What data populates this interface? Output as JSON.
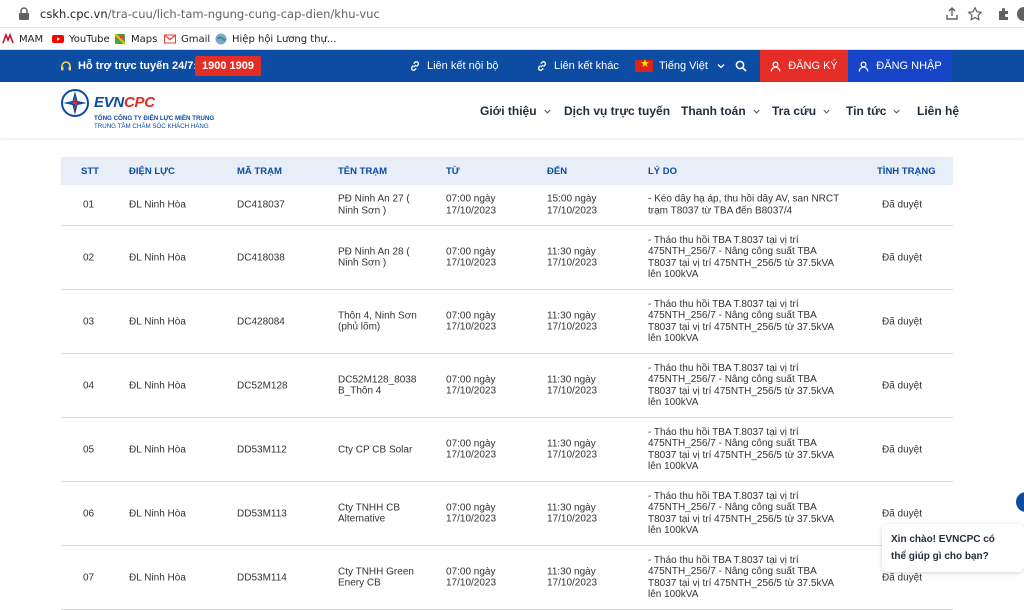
{
  "browser": {
    "url_host": "cskh.cpc.vn",
    "url_path": "/tra-cuu/lich-tam-ngung-cung-cap-dien/khu-vuc",
    "bookmarks": [
      {
        "label": "MAM",
        "icon": "mam-icon"
      },
      {
        "label": "YouTube",
        "icon": "youtube-icon"
      },
      {
        "label": "Maps",
        "icon": "maps-icon"
      },
      {
        "label": "Gmail",
        "icon": "gmail-icon"
      },
      {
        "label": "Hiệp hội Lương thự...",
        "icon": "globe-icon"
      }
    ]
  },
  "topbar": {
    "support_label": "Hỗ trợ trực tuyến 24/7:",
    "hotline": "1900 1909",
    "link_internal": "Liên kết nội bộ",
    "link_external": "Liên kết khác",
    "language": "Tiếng Việt",
    "register": "ĐĂNG KÝ",
    "login": "ĐĂNG NHẬP",
    "colors": {
      "bar": "#0c4ca3",
      "register": "#e52d27",
      "login": "#1745c8"
    }
  },
  "logo": {
    "brand_evn": "EVN",
    "brand_cpc": "CPC",
    "line1": "TỔNG CÔNG TY ĐIỆN LỰC MIỀN TRUNG",
    "line2": "TRUNG TÂM CHĂM SÓC KHÁCH HÀNG"
  },
  "nav": {
    "items": [
      {
        "label": "Giới thiệu",
        "dropdown": true
      },
      {
        "label": "Dịch vụ trực tuyến",
        "dropdown": false
      },
      {
        "label": "Thanh toán",
        "dropdown": true
      },
      {
        "label": "Tra cứu",
        "dropdown": true
      },
      {
        "label": "Tin tức",
        "dropdown": true
      },
      {
        "label": "Liên hệ",
        "dropdown": false
      }
    ]
  },
  "table": {
    "headers": [
      "STT",
      "ĐIỆN LỰC",
      "MÃ TRẠM",
      "TÊN TRẠM",
      "TỪ",
      "ĐẾN",
      "LÝ DO",
      "TÌNH TRẠNG"
    ],
    "rows": [
      {
        "stt": "01",
        "dien_luc": "ĐL Ninh Hòa",
        "ma_tram": "DC418037",
        "ten_tram": [
          "PĐ Ninh An 27 (",
          "Ninh Sơn )"
        ],
        "tu": [
          "07:00 ngày",
          "17/10/2023"
        ],
        "den": [
          "15:00 ngày",
          "17/10/2023"
        ],
        "ly_do": [
          "- Kéo dây hạ áp, thu hồi dây AV, san NRCT",
          "trạm T8037 từ TBA đến B8037/4"
        ],
        "tinh_trang": "Đã duyệt"
      },
      {
        "stt": "02",
        "dien_luc": "ĐL Ninh Hòa",
        "ma_tram": "DC418038",
        "ten_tram": [
          "PĐ Ninh An 28 (",
          "Ninh Sơn )"
        ],
        "tu": [
          "07:00 ngày",
          "17/10/2023"
        ],
        "den": [
          "11:30 ngày",
          "17/10/2023"
        ],
        "ly_do": [
          "- Tháo thu hồi TBA T.8037 tại vị trí",
          "475NTH_256/7 - Nâng công suất TBA",
          "T8037 tại vị trí 475NTH_256/5 từ 37.5kVA",
          "lên 100kVA"
        ],
        "tinh_trang": "Đã duyệt"
      },
      {
        "stt": "03",
        "dien_luc": "ĐL Ninh Hòa",
        "ma_tram": "DC428084",
        "ten_tram": [
          "Thôn 4, Ninh Sơn",
          "(phủ lõm)"
        ],
        "tu": [
          "07:00 ngày",
          "17/10/2023"
        ],
        "den": [
          "11:30 ngày",
          "17/10/2023"
        ],
        "ly_do": [
          "- Tháo thu hồi TBA T.8037 tại vị trí",
          "475NTH_256/7 - Nâng công suất TBA",
          "T8037 tại vị trí 475NTH_256/5 từ 37.5kVA",
          "lên 100kVA"
        ],
        "tinh_trang": "Đã duyệt"
      },
      {
        "stt": "04",
        "dien_luc": "ĐL Ninh Hòa",
        "ma_tram": "DC52M128",
        "ten_tram": [
          "DC52M128_8038",
          "B_Thôn 4"
        ],
        "tu": [
          "07:00 ngày",
          "17/10/2023"
        ],
        "den": [
          "11:30 ngày",
          "17/10/2023"
        ],
        "ly_do": [
          "- Tháo thu hồi TBA T.8037 tại vị trí",
          "475NTH_256/7 - Nâng công suất TBA",
          "T8037 tại vị trí 475NTH_256/5 từ 37.5kVA",
          "lên 100kVA"
        ],
        "tinh_trang": "Đã duyệt"
      },
      {
        "stt": "05",
        "dien_luc": "ĐL Ninh Hòa",
        "ma_tram": "DD53M112",
        "ten_tram": [
          "Cty CP CB Solar"
        ],
        "tu": [
          "07:00 ngày",
          "17/10/2023"
        ],
        "den": [
          "11:30 ngày",
          "17/10/2023"
        ],
        "ly_do": [
          "- Tháo thu hồi TBA T.8037 tại vị trí",
          "475NTH_256/7 - Nâng công suất TBA",
          "T8037 tại vị trí 475NTH_256/5 từ 37.5kVA",
          "lên 100kVA"
        ],
        "tinh_trang": "Đã duyệt"
      },
      {
        "stt": "06",
        "dien_luc": "ĐL Ninh Hòa",
        "ma_tram": "DD53M113",
        "ten_tram": [
          "Cty TNHH CB",
          "Alternative"
        ],
        "tu": [
          "07:00 ngày",
          "17/10/2023"
        ],
        "den": [
          "11:30 ngày",
          "17/10/2023"
        ],
        "ly_do": [
          "- Tháo thu hồi TBA T.8037 tại vị trí",
          "475NTH_256/7 - Nâng công suất TBA",
          "T8037 tại vị trí 475NTH_256/5 từ 37.5kVA",
          "lên 100kVA"
        ],
        "tinh_trang": "Đã duyệt"
      },
      {
        "stt": "07",
        "dien_luc": "ĐL Ninh Hòa",
        "ma_tram": "DD53M114",
        "ten_tram": [
          "Cty TNHH Green",
          "Enery CB"
        ],
        "tu": [
          "07:00 ngày",
          "17/10/2023"
        ],
        "den": [
          "11:30 ngày",
          "17/10/2023"
        ],
        "ly_do": [
          "- Tháo thu hồi TBA T.8037 tại vị trí",
          "475NTH_256/7 - Nâng công suất TBA",
          "T8037 tại vị trí 475NTH_256/5 từ 37.5kVA",
          "lên 100kVA"
        ],
        "tinh_trang": "Đã duyệt"
      }
    ]
  },
  "chat": {
    "line1": "Xin chào! EVNCPC có",
    "line2": "thể giúp gì cho bạn?"
  }
}
